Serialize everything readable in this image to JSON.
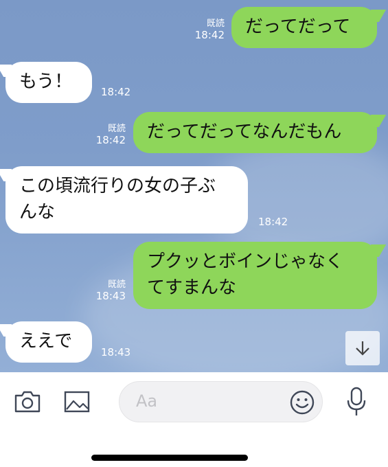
{
  "messages": [
    {
      "side": "out",
      "text": "だってだって",
      "read": "既読",
      "time": "18:42"
    },
    {
      "side": "in",
      "text": "もう！",
      "time": "18:42"
    },
    {
      "side": "out",
      "text": "だってだってなんだもん",
      "read": "既読",
      "time": "18:42"
    },
    {
      "side": "in",
      "lines": [
        "この頃流行りの女の子ぶ",
        "んな"
      ],
      "time": "18:42"
    },
    {
      "side": "out",
      "lines": [
        "プクッとボインじゃなく",
        "てすまんな"
      ],
      "read": "既読",
      "time": "18:43"
    },
    {
      "side": "in",
      "text": "ええで",
      "time": "18:43"
    }
  ],
  "input": {
    "placeholder": "Aa"
  },
  "icons": {
    "camera": "camera-icon",
    "image": "image-icon",
    "emoji": "emoji-icon",
    "mic": "microphone-icon",
    "scroll": "arrow-down-icon"
  },
  "colors": {
    "chat_bg": "#7f9dca",
    "out_bubble": "#8ed65a",
    "in_bubble": "#ffffff"
  }
}
